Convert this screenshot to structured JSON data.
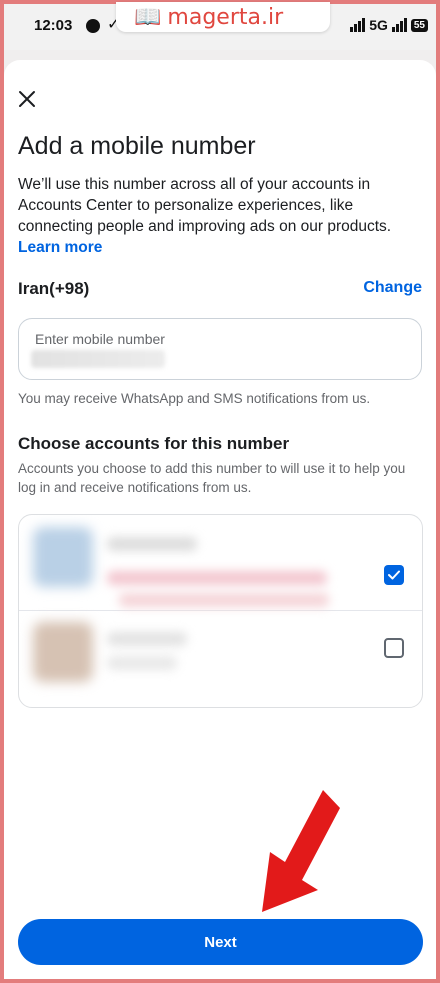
{
  "status_bar": {
    "time": "12:03",
    "network": "5G",
    "battery": "55"
  },
  "watermark": {
    "text": "magerta.ir"
  },
  "dialog": {
    "title": "Add a mobile number",
    "description": "We’ll use this number across all of your accounts in Accounts Center to personalize experiences, like connecting people and improving ads on our products.",
    "learn_more": "Learn more",
    "country": "Iran(+98)",
    "change_label": "Change",
    "phone_placeholder": "Enter mobile number",
    "notice": "You may receive WhatsApp and SMS notifications from us.",
    "accounts_title": "Choose accounts for this number",
    "accounts_subtitle": "Accounts you choose to add this number to will use it to help you log in and receive notifications from us.",
    "accounts": [
      {
        "checked": true
      },
      {
        "checked": false
      }
    ],
    "next_label": "Next"
  },
  "colors": {
    "primary": "#0064e0",
    "frame": "#e37c7c",
    "arrow": "#e21a1a"
  }
}
